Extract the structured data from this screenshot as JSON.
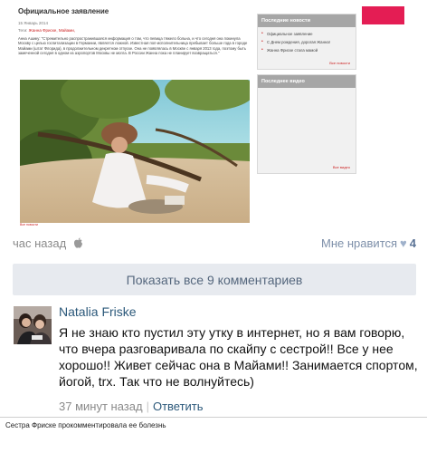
{
  "article": {
    "title": "Официальное заявление",
    "date": "15 Январь 2014",
    "tags_label": "Теги:",
    "tags": "Жанна Фриске, Майами,",
    "body": "Анна Ашику: \"Стремительно распространившаяся информация о том, что певица тяжело больна, и что сегодня она покинула Москву с целью госпитализации в Германии, является ложной. Известная поп-исполнительница пребывает больше года в городе Майами (штат Флорида), в продолжительном декретном отпуске. Она не появлялась в Москве с января 2013 года, поэтому быть замеченной сегодня в одном из аэропортов Москвы не могла. В России Жанна пока не планирует возвращаться.\"",
    "photo_caption": "Все новости"
  },
  "sidebar": {
    "news_title": "Последние новости",
    "news_items": [
      "Официальное заявление",
      "С Днем рождения, дорогая Жанна!",
      "Жанна Фриске стала мамой"
    ],
    "news_all": "Все новости",
    "video_title": "Последнее видео",
    "video_all": "Все видео"
  },
  "post": {
    "time": "час назад",
    "likes_label": "Мне нравится",
    "likes_count": "4"
  },
  "show_all_comments": "Показать все 9 комментариев",
  "comment": {
    "author": "Natalia Friske",
    "text": "Я не знаю кто пустил эту утку в интернет, но я вам говорю, что вчера разговаривала по скайпу с сестрой!! Все у нее хорошо!! Живет сейчас она в Майами!! Занимается спортом, йогой, trx. Так что не волнуйтесь)",
    "time": "37 минут назад",
    "separator": "|",
    "reply": "Ответить"
  },
  "caption": "Сестра Фриске прокомментировала ее болезнь",
  "colors": {
    "accent_pink": "#e41d54",
    "link_blue": "#2b587a",
    "muted_gray": "#8a8a8a",
    "button_bg": "#e7eaef"
  }
}
